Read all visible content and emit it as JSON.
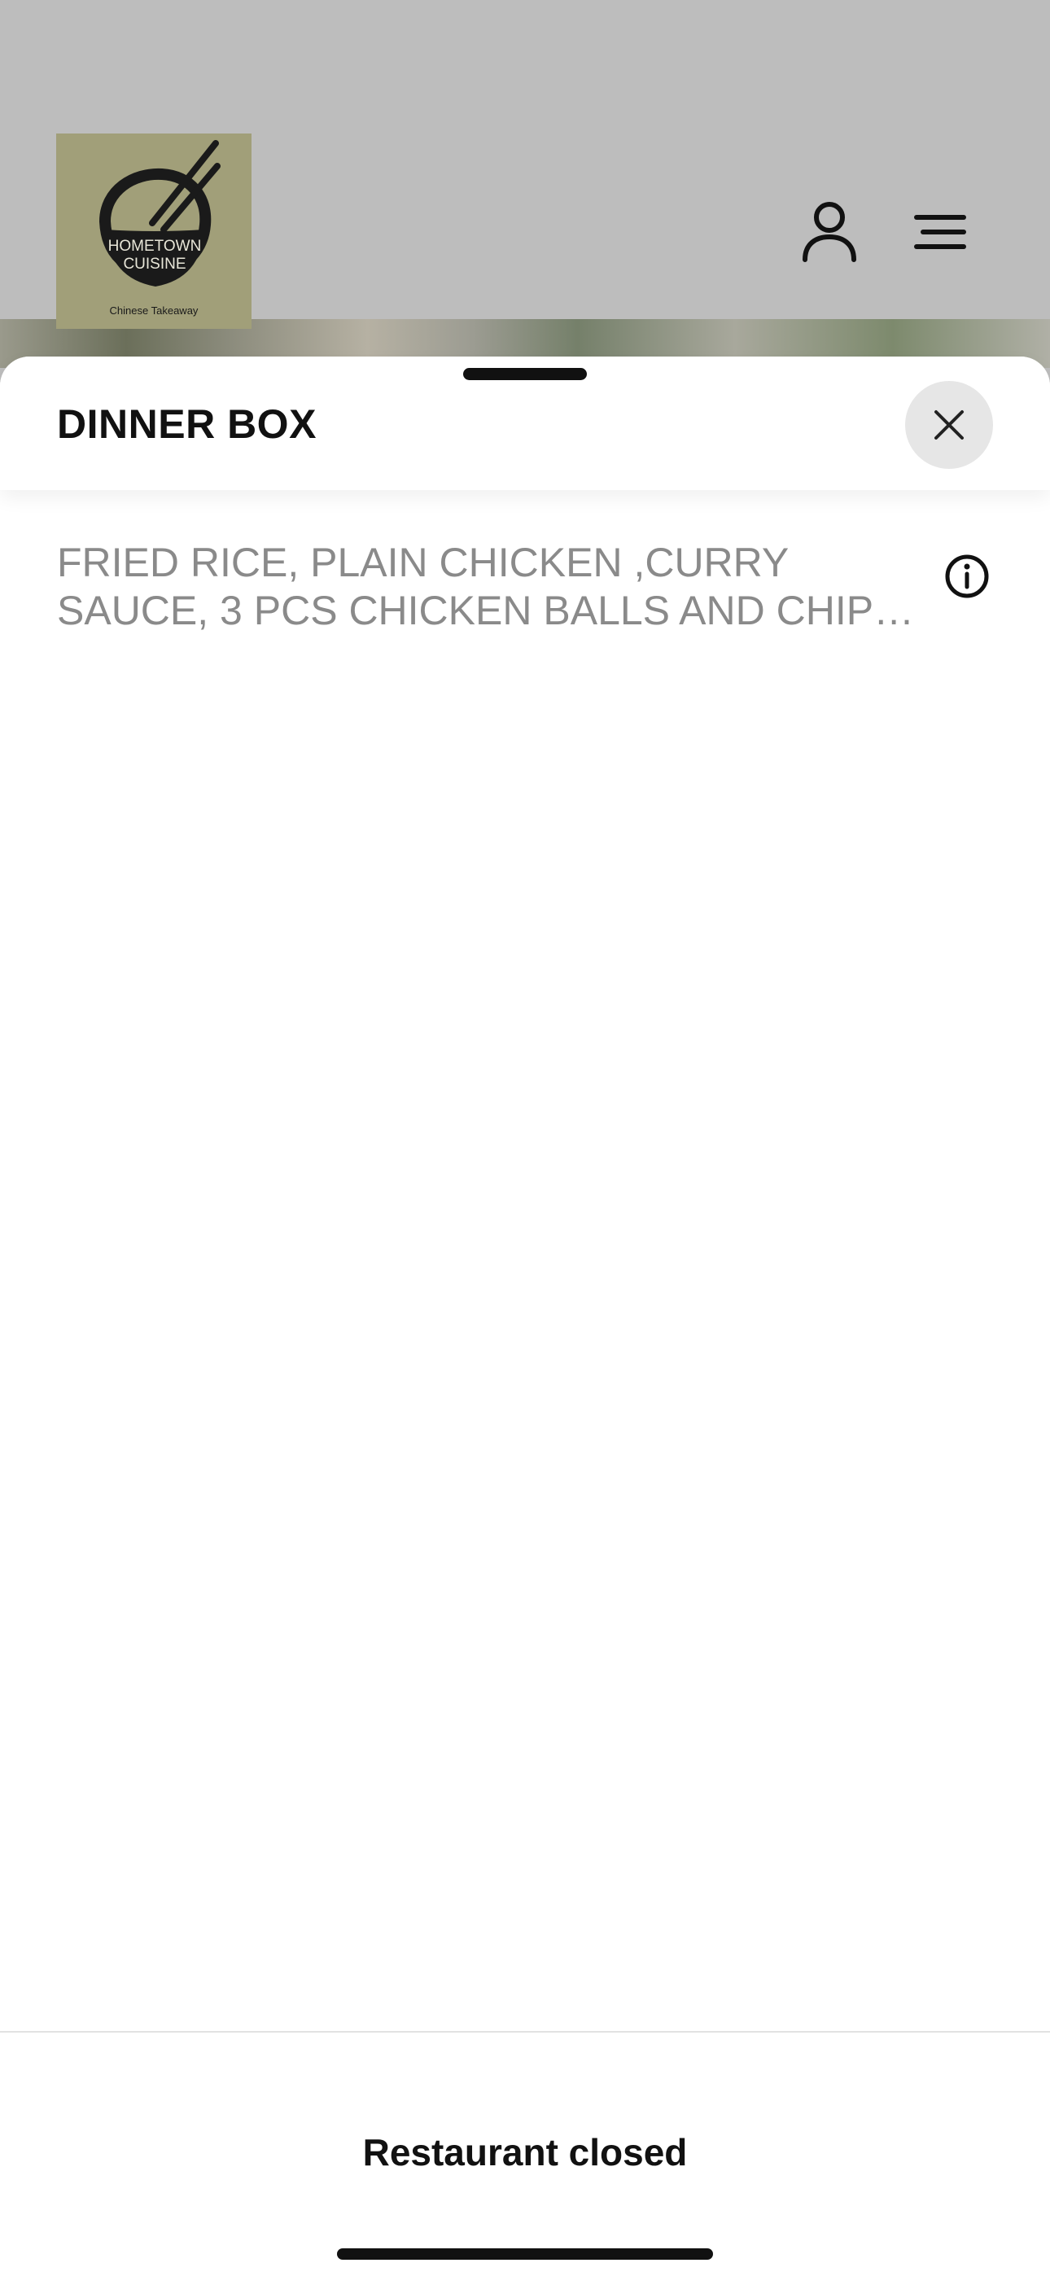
{
  "header": {
    "logo": {
      "brand_line1": "HOMETOWN",
      "brand_line2": "CUISINE",
      "tagline": "Chinese Takeaway",
      "background": "#a19f79"
    },
    "icons": [
      "user-icon",
      "menu-icon"
    ]
  },
  "sheet": {
    "title": "DINNER BOX",
    "description": "FRIED RICE, PLAIN CHICKEN ,CURRY SAUCE, 3 PCS CHICKEN BALLS AND CHIPS WITH SE...",
    "close_icon": "close-icon",
    "info_icon": "info-icon"
  },
  "footer": {
    "status": "Restaurant closed"
  },
  "colors": {
    "header_background": "#bdbdbd",
    "description_text": "#8a8a8a",
    "close_button_background": "#e6e6e6"
  }
}
